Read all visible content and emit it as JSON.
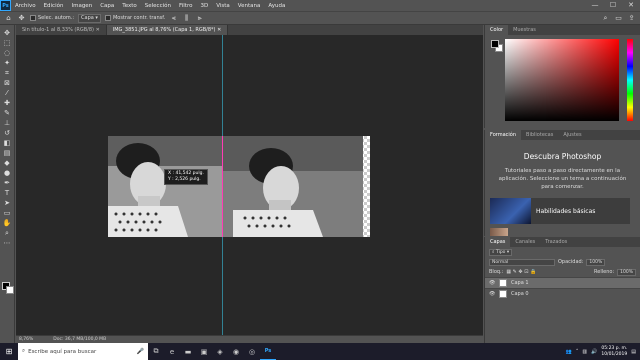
{
  "app": {
    "logo": "Ps"
  },
  "menu": [
    "Archivo",
    "Edición",
    "Imagen",
    "Capa",
    "Texto",
    "Selección",
    "Filtro",
    "3D",
    "Vista",
    "Ventana",
    "Ayuda"
  ],
  "window_controls": {
    "minimize": "—",
    "maximize": "☐",
    "close": "✕"
  },
  "options_bar": {
    "auto_select_label": "Selec. autom.:",
    "target_value": "Capa",
    "show_transform_label": "Mostrar contr. transf."
  },
  "tabs": [
    {
      "label": "Sin título-1 al 8,33% (RGB/8)"
    },
    {
      "label": "IMG_3851.JPG al 8,76% (Capa 1, RGB/8*)"
    }
  ],
  "tooltip": {
    "x": "X :  41,542 pulg.",
    "y": "Y :    2,526 pulg."
  },
  "status": {
    "zoom": "8,76%",
    "doc": "Doc: 36,7 MB/100,0 MB"
  },
  "color_panel": {
    "tabs": [
      "Color",
      "Muestras"
    ],
    "fg": "#000000",
    "bg": "#ffffff"
  },
  "learn_panel": {
    "tabs": [
      "Formación",
      "Bibliotecas",
      "Ajustes"
    ],
    "title": "Descubra Photoshop",
    "description": "Tutoriales paso a paso directamente en la aplicación. Seleccione un tema a continuación para comenzar.",
    "card_label": "Habilidades básicas"
  },
  "layers_panel": {
    "tabs": [
      "Capas",
      "Canales",
      "Trazados"
    ],
    "filter": "Tipo",
    "blend_mode": "Normal",
    "opacity_label": "Opacidad:",
    "opacity_value": "100%",
    "lock_label": "Bloq.:",
    "fill_label": "Relleno:",
    "fill_value": "100%",
    "layers": [
      {
        "name": "Capa 1",
        "selected": true
      },
      {
        "name": "Capa 0",
        "selected": false
      }
    ]
  },
  "taskbar": {
    "search_placeholder": "Escribe aquí para buscar",
    "ps_label": "Ps",
    "time": "05:23 p. m.",
    "date": "10/01/2019"
  },
  "colors": {
    "accent": "#31a8ff",
    "ui_bg": "#535353",
    "canvas_bg": "#282828"
  }
}
